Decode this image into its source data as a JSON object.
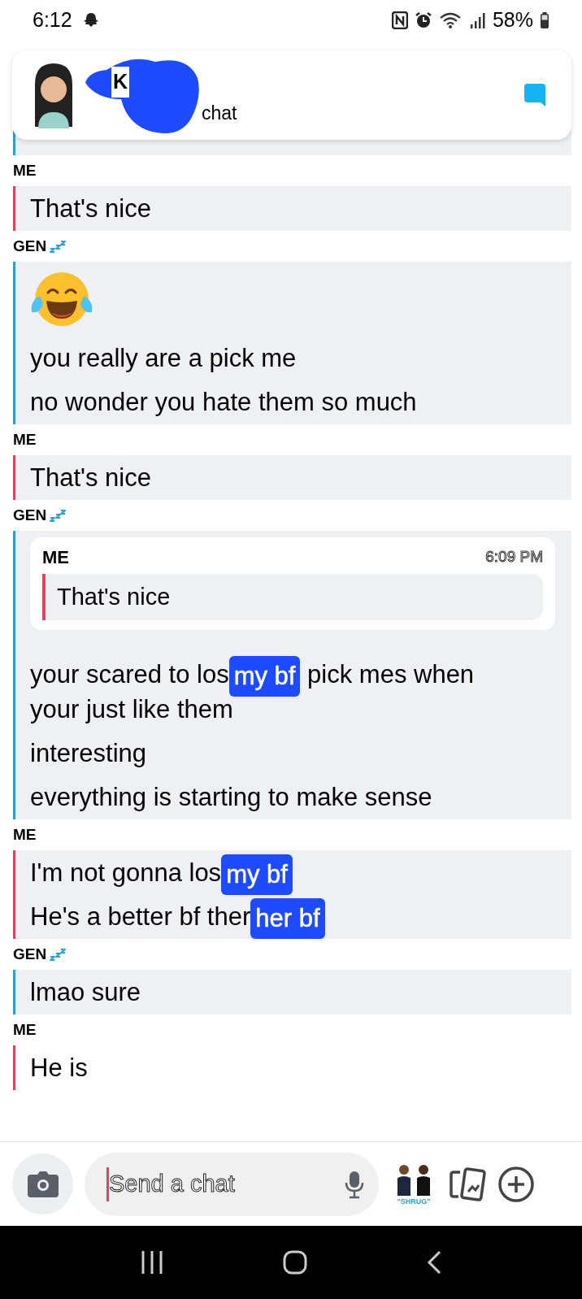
{
  "status_bar": {
    "time": "6:12",
    "battery": "58%"
  },
  "header": {
    "name": "K",
    "subtitle": "chat"
  },
  "messages": [
    {
      "sender": "ME",
      "kind": "me",
      "shaded": true,
      "items": [
        {
          "kind": "text",
          "parts": [
            {
              "kind": "plain",
              "text": "That's nice"
            }
          ]
        }
      ]
    },
    {
      "sender": "GEN",
      "kind": "them",
      "sleeping": true,
      "shaded": true,
      "items": [
        {
          "kind": "emoji"
        },
        {
          "kind": "text",
          "parts": [
            {
              "kind": "plain",
              "text": "you really are a pick me"
            }
          ]
        },
        {
          "kind": "text",
          "parts": [
            {
              "kind": "plain",
              "text": "no wonder you hate them so much"
            }
          ]
        }
      ]
    },
    {
      "sender": "ME",
      "kind": "me",
      "shaded": true,
      "items": [
        {
          "kind": "text",
          "parts": [
            {
              "kind": "plain",
              "text": "That's nice"
            }
          ]
        }
      ]
    },
    {
      "sender": "GEN",
      "kind": "them",
      "sleeping": true,
      "shaded": true,
      "items": [
        {
          "kind": "quote",
          "sender": "ME",
          "time": "6:09 PM",
          "text": "That's nice"
        },
        {
          "kind": "text",
          "parts": [
            {
              "kind": "plain",
              "text": "your scared to los"
            },
            {
              "kind": "redaction",
              "text": "my bf"
            },
            {
              "kind": "plain",
              "text": " pick mes when"
            },
            {
              "kind": "line",
              "text": "your just like them"
            }
          ]
        },
        {
          "kind": "text",
          "parts": [
            {
              "kind": "plain",
              "text": "interesting"
            }
          ]
        },
        {
          "kind": "text",
          "parts": [
            {
              "kind": "plain",
              "text": "everything is starting to make sense"
            }
          ]
        }
      ]
    },
    {
      "sender": "ME",
      "kind": "me",
      "shaded": true,
      "items": [
        {
          "kind": "text",
          "parts": [
            {
              "kind": "plain",
              "text": "I'm not gonna los"
            },
            {
              "kind": "redaction",
              "text": "my bf"
            }
          ]
        },
        {
          "kind": "text",
          "parts": [
            {
              "kind": "plain",
              "text": "He's a better bf ther"
            },
            {
              "kind": "redaction",
              "text": "her bf"
            }
          ]
        }
      ]
    },
    {
      "sender": "GEN",
      "kind": "them",
      "sleeping": true,
      "shaded": true,
      "items": [
        {
          "kind": "text",
          "parts": [
            {
              "kind": "plain",
              "text": "lmao sure"
            }
          ]
        }
      ]
    },
    {
      "sender": "ME",
      "kind": "me",
      "shaded": false,
      "items": [
        {
          "kind": "text",
          "parts": [
            {
              "kind": "plain",
              "text": "He is"
            }
          ]
        }
      ]
    }
  ],
  "composer": {
    "placeholder": "Send a chat",
    "sticker_label": "\"SHRUG\""
  }
}
